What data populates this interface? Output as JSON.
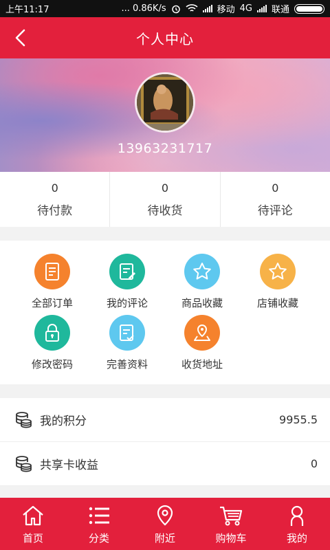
{
  "status_bar": {
    "time": "上午11:17",
    "net_speed": "... 0.86K/s",
    "carrier1": "移动",
    "network": "4G",
    "carrier2": "联通"
  },
  "header": {
    "title": "个人中心"
  },
  "profile": {
    "phone": "13963231717"
  },
  "orders": [
    {
      "count": "0",
      "label": "待付款"
    },
    {
      "count": "0",
      "label": "待收货"
    },
    {
      "count": "0",
      "label": "待评论"
    }
  ],
  "menu": [
    {
      "label": "全部订单",
      "icon": "document-icon",
      "color": "#f5822d"
    },
    {
      "label": "我的评论",
      "icon": "edit-note-icon",
      "color": "#1fb89c"
    },
    {
      "label": "商品收藏",
      "icon": "star-icon",
      "color": "#5ec8ef"
    },
    {
      "label": "店铺收藏",
      "icon": "star-icon",
      "color": "#f7b248"
    },
    {
      "label": "修改密码",
      "icon": "lock-icon",
      "color": "#1fb89c"
    },
    {
      "label": "完善资料",
      "icon": "checklist-icon",
      "color": "#5ec8ef"
    },
    {
      "label": "收货地址",
      "icon": "map-pin-icon",
      "color": "#f5822d"
    }
  ],
  "list": [
    {
      "label": "我的积分",
      "value": "9955.5",
      "icon": "coins-icon"
    },
    {
      "label": "共享卡收益",
      "value": "0",
      "icon": "coins-icon"
    }
  ],
  "tabs": [
    {
      "label": "首页",
      "icon": "home-icon"
    },
    {
      "label": "分类",
      "icon": "list-icon"
    },
    {
      "label": "附近",
      "icon": "location-icon"
    },
    {
      "label": "购物车",
      "icon": "cart-icon"
    },
    {
      "label": "我的",
      "icon": "user-icon"
    }
  ],
  "colors": {
    "brand": "#e3203c",
    "background": "#f2f2f2"
  }
}
